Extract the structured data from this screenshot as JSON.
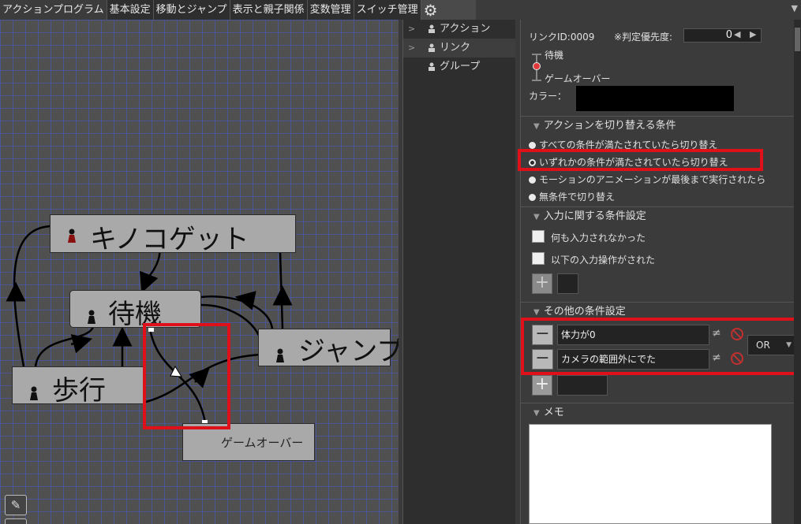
{
  "tabs": [
    "アクションプログラム",
    "基本設定",
    "移動とジャンプ",
    "表示と親子関係",
    "変数管理",
    "スイッチ管理"
  ],
  "graph": {
    "nodes": {
      "kinoko": "キノコゲット",
      "taiki": "待機",
      "jump": "ジャンプ",
      "hokou": "歩行",
      "gameover": "ゲームオーバー"
    }
  },
  "tree": {
    "items": [
      {
        "label": "アクション"
      },
      {
        "label": "リンク"
      },
      {
        "label": "グループ"
      }
    ]
  },
  "props": {
    "link_id": "リンクID:0009",
    "priority_label": "※判定優先度:",
    "priority_value": "0",
    "from_action": "待機",
    "to_action": "ゲームオーバー",
    "color_label": "カラー：",
    "color_value": "#000000",
    "switch_section": "アクションを切り替える条件",
    "switch_options": [
      "すべての条件が満たされていたら切り替え",
      "いずれかの条件が満たされていたら切り替え",
      "モーションのアニメーションが最後まで実行されたら",
      "無条件で切り替え"
    ],
    "selected_option_index": 1,
    "input_section": "入力に関する条件設定",
    "input_options": [
      "何も入力されなかった",
      "以下の入力操作がされた"
    ],
    "other_section": "その他の条件設定",
    "conditions": [
      "体力が0",
      "カメラの範囲外にでた"
    ],
    "logic": "OR",
    "memo_section": "メモ",
    "memo_text": ""
  },
  "colors": {
    "highlight": "#e0101a",
    "grid": "#4a5ccb",
    "node": "#a9a9a9"
  }
}
